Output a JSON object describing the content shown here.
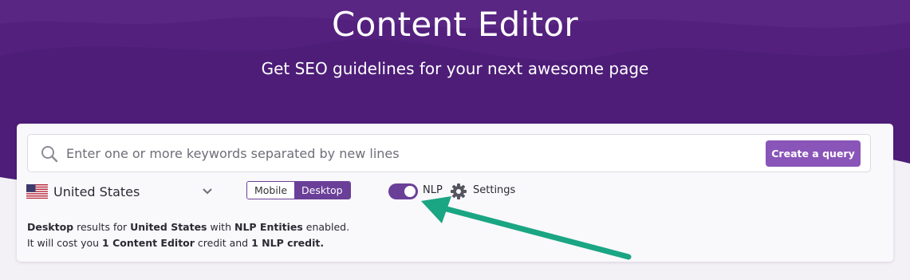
{
  "header": {
    "title": "Content Editor",
    "subtitle": "Get SEO guidelines for your next awesome page"
  },
  "search": {
    "placeholder": "Enter one or more keywords separated by new lines",
    "icon": "search-icon",
    "button_label": "Create a query"
  },
  "options": {
    "country": "United States",
    "country_flag": "us-flag-icon",
    "device_options": [
      "Mobile",
      "Desktop"
    ],
    "device_selected": "Desktop",
    "nlp_label": "NLP",
    "nlp_enabled": true,
    "settings_label": "Settings"
  },
  "info": {
    "line1": {
      "device": "Desktop",
      "t1": " results for ",
      "country": "United States",
      "t2": " with ",
      "feature": "NLP Entities",
      "t3": " enabled."
    },
    "line2": {
      "t1": "It will cost you ",
      "credit1": "1 Content Editor",
      "t2": " credit and ",
      "credit2": "1 NLP credit."
    }
  },
  "colors": {
    "hero_bg": "#4d1d78",
    "accent": "#6a3f98",
    "button": "#8a55b8",
    "arrow": "#1aa583"
  }
}
